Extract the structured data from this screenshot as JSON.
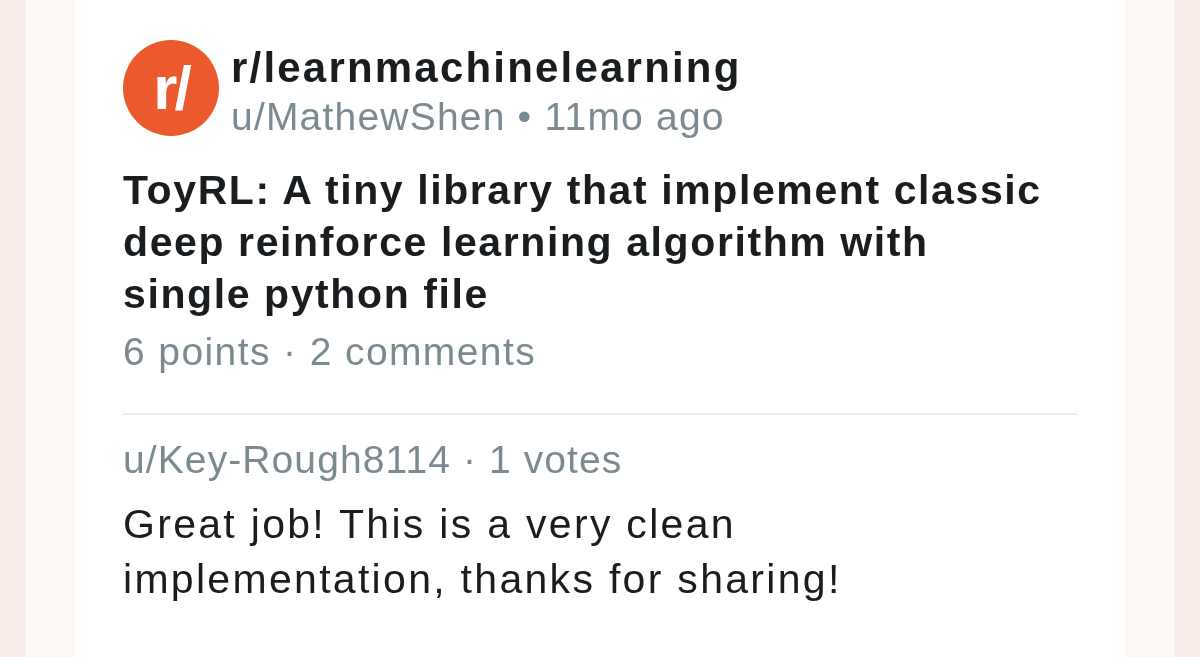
{
  "subreddit": {
    "icon_text": "r/",
    "name": "r/learnmachinelearning",
    "byline": "u/MathewShen • 11mo ago"
  },
  "post": {
    "title": "ToyRL: A tiny library that implement classic deep reinforce learning algorithm with single python file",
    "stats": "6 points · 2 comments"
  },
  "comments": [
    {
      "meta": "u/Key-Rough8114 · 1 votes",
      "body": "Great job! This is a very clean implementation, thanks for sharing!"
    }
  ]
}
